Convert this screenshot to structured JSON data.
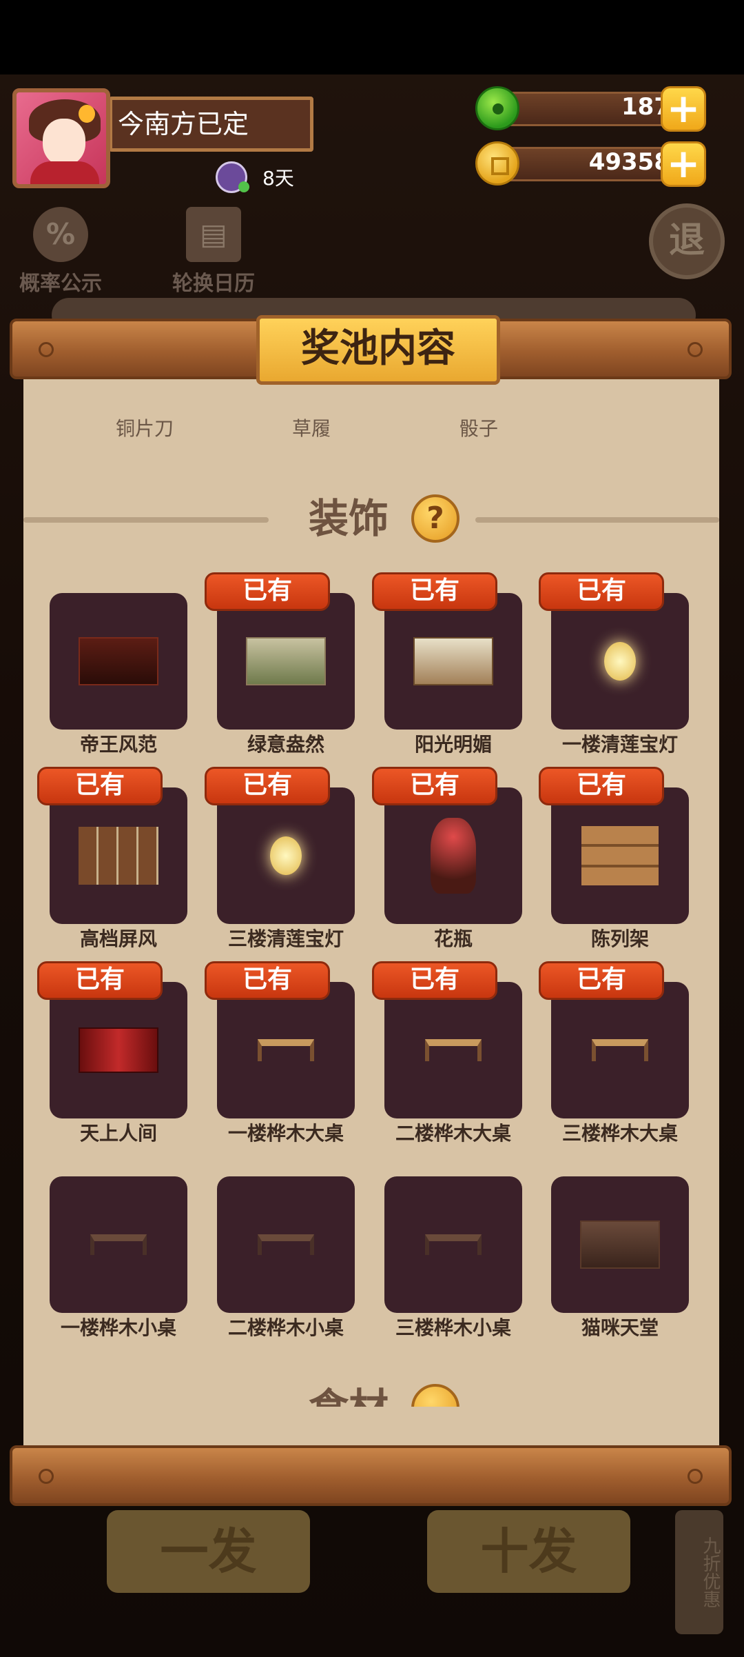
{
  "player": {
    "name": "今南方已定",
    "days": "8天"
  },
  "currency": {
    "jade": "187",
    "coins": "49358",
    "plus": "+"
  },
  "background": {
    "probability": "概率公示",
    "calendar": "轮换日历",
    "exit": "退",
    "single_draw": "一发",
    "ten_draw": "十发",
    "discount": "九折优惠"
  },
  "panel": {
    "title": "奖池内容",
    "cut_labels": [
      "铜片刀",
      "草履",
      "骰子"
    ],
    "section_title": "装饰",
    "help": "?",
    "next_section": "食材",
    "owned_label": "已有",
    "items": [
      {
        "name": "帝王风范",
        "owned": false
      },
      {
        "name": "绿意盎然",
        "owned": true
      },
      {
        "name": "阳光明媚",
        "owned": true
      },
      {
        "name": "一楼清莲宝灯",
        "owned": true
      },
      {
        "name": "高档屏风",
        "owned": true
      },
      {
        "name": "三楼清莲宝灯",
        "owned": true
      },
      {
        "name": "花瓶",
        "owned": true
      },
      {
        "name": "陈列架",
        "owned": true
      },
      {
        "name": "天上人间",
        "owned": true
      },
      {
        "name": "一楼桦木大桌",
        "owned": true
      },
      {
        "name": "二楼桦木大桌",
        "owned": true
      },
      {
        "name": "三楼桦木大桌",
        "owned": true
      },
      {
        "name": "一楼桦木小桌",
        "owned": false
      },
      {
        "name": "二楼桦木小桌",
        "owned": false
      },
      {
        "name": "三楼桦木小桌",
        "owned": false
      },
      {
        "name": "猫咪天堂",
        "owned": false
      }
    ]
  },
  "colors": {
    "panel_bg": "#d8c3a5",
    "tile_bg": "#3b2029",
    "badge_bg": "#d9431a",
    "title_plate": "#f4be45"
  }
}
